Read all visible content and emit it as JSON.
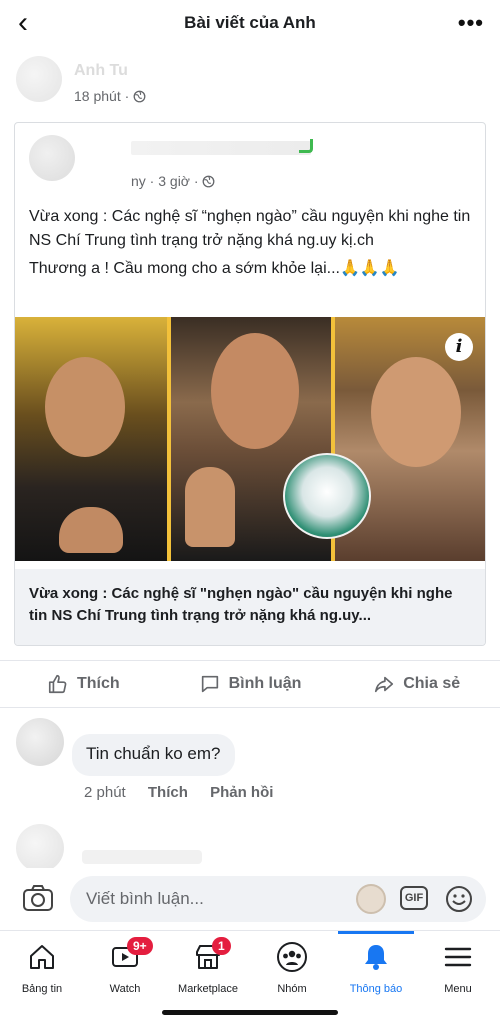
{
  "header": {
    "title": "Bài viết của Anh",
    "back_icon": "chevron-left-icon",
    "more_icon": "more-horizontal-icon"
  },
  "post": {
    "author_name": "Anh Tu",
    "time": "18 phút · ",
    "privacy_icon": "globe-icon"
  },
  "shared": {
    "meta": "ny · 3 giờ · ",
    "text_lines": [
      "Vừa xong : Các nghệ sĩ “nghẹn ngào” cầu nguyện khi nghe tin NS Chí Trung tình trạng trở nặng khá ng.uy kị.ch",
      "Thương a ! Cầu mong cho a sớm khỏe lại...🙏🙏🙏"
    ],
    "link_caption": "Vừa xong : Các nghệ sĩ \"nghẹn ngào\" cầu nguyện khi nghe tin NS Chí Trung tình trạng trở nặng khá ng.uy..."
  },
  "actions": {
    "like": "Thích",
    "comment": "Bình luận",
    "share": "Chia sẻ"
  },
  "comments": [
    {
      "text": "Tin chuẩn ko em?",
      "time": "2 phút",
      "like": "Thích",
      "reply": "Phản hồi"
    }
  ],
  "composer": {
    "placeholder": "Viết bình luận...",
    "gif": "GIF"
  },
  "tabbar": {
    "tabs": [
      {
        "label": "Bảng tin",
        "icon": "home-icon"
      },
      {
        "label": "Watch",
        "icon": "watch-icon",
        "badge": "9+"
      },
      {
        "label": "Marketplace",
        "icon": "marketplace-icon",
        "badge": "1"
      },
      {
        "label": "Nhóm",
        "icon": "groups-icon"
      },
      {
        "label": "Thông báo",
        "icon": "bell-icon"
      },
      {
        "label": "Menu",
        "icon": "menu-icon"
      }
    ]
  },
  "colors": {
    "accent": "#1877f2",
    "badge": "#e41e3f",
    "muted": "#65676b"
  }
}
